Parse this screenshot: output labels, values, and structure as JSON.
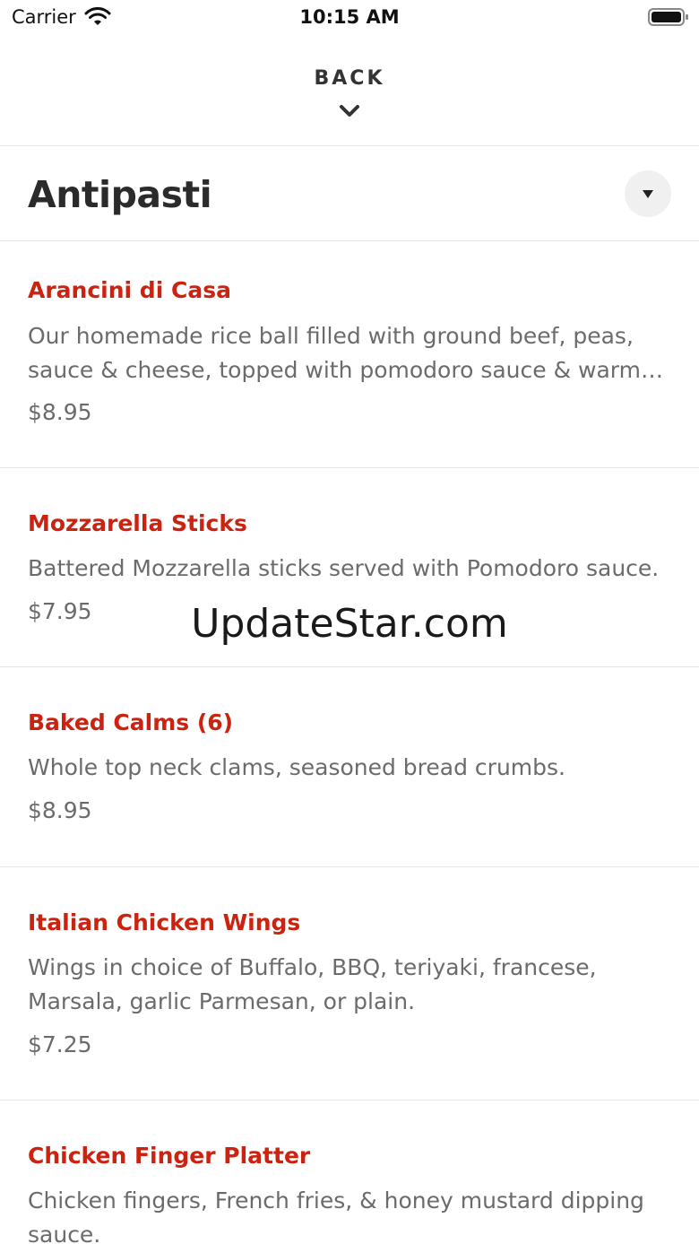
{
  "status_bar": {
    "carrier": "Carrier",
    "time": "10:15 AM",
    "wifi_icon": "wifi-icon",
    "battery_icon": "battery-icon"
  },
  "header": {
    "back_label": "BACK",
    "chevron_icon": "chevron-down-icon"
  },
  "section": {
    "title": "Antipasti",
    "toggle_icon": "triangle-down-icon"
  },
  "items": [
    {
      "name": "Arancini di Casa",
      "description": "Our homemade rice ball filled with ground beef, peas, sauce & cheese, topped with pomodoro sauce & warm R...",
      "price": "$8.95"
    },
    {
      "name": "Mozzarella Sticks",
      "description": "Battered Mozzarella sticks served with Pomodoro sauce.",
      "price": "$7.95"
    },
    {
      "name": "Baked Calms (6)",
      "description": "Whole top neck clams, seasoned bread crumbs.",
      "price": "$8.95"
    },
    {
      "name": "Italian Chicken Wings",
      "description": "Wings in choice of Buffalo, BBQ, teriyaki, francese, Marsala, garlic Parmesan, or plain.",
      "price": "$7.25"
    },
    {
      "name": "Chicken Finger Platter",
      "description": "Chicken fingers, French fries, & honey mustard dipping sauce.",
      "price": ""
    }
  ],
  "watermark": "UpdateStar.com",
  "colors": {
    "item_name": "#cc2311",
    "body_text": "#6b6b6b",
    "title_text": "#2b2b2b",
    "divider": "#e4e4e4"
  }
}
